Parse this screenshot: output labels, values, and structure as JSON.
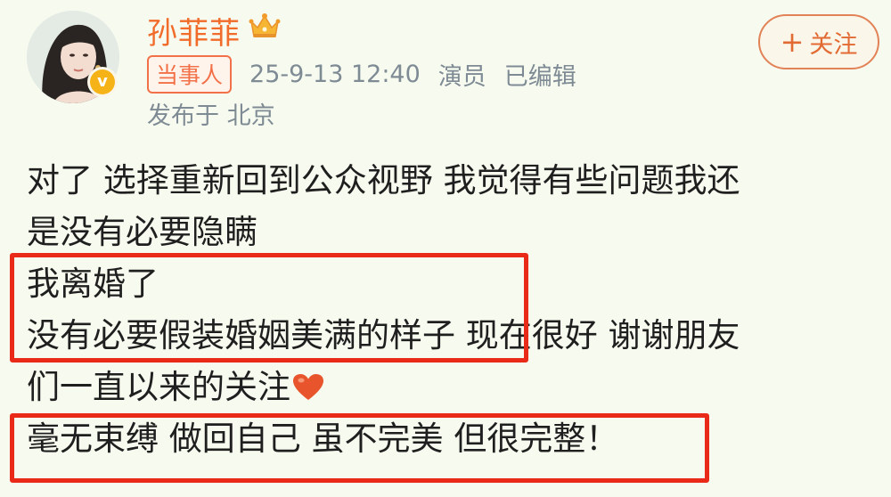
{
  "user": {
    "name": "孙菲菲",
    "avatar_icon": "avatar-photo",
    "verified_icon": "verified-badge-icon",
    "verified_symbol": "v",
    "crown_icon": "vip-crown-icon"
  },
  "meta": {
    "badge": "当事人",
    "timestamp": "25-9-13 12:40",
    "role": "演员",
    "edited": "已编辑"
  },
  "location": "发布于 北京",
  "follow_button": {
    "icon": "+",
    "label": "关注"
  },
  "post": {
    "lines": [
      "对了 选择重新回到公众视野 我觉得有些问题我还",
      "是没有必要隐瞒",
      "我离婚了",
      "没有必要假装婚姻美满的样子 现在很好 谢谢朋友",
      "们一直以来的关注",
      "毫无束缚 做回自己 虽不完美 但很完整！"
    ],
    "heart_icon": "heart-emoji"
  },
  "colors": {
    "background": "#f7fbef",
    "username": "#f16b2a",
    "meta_text": "#7e8a94",
    "highlight_box": "#ea2a18",
    "follow": "#e26b34",
    "verified": "#f5b318"
  }
}
